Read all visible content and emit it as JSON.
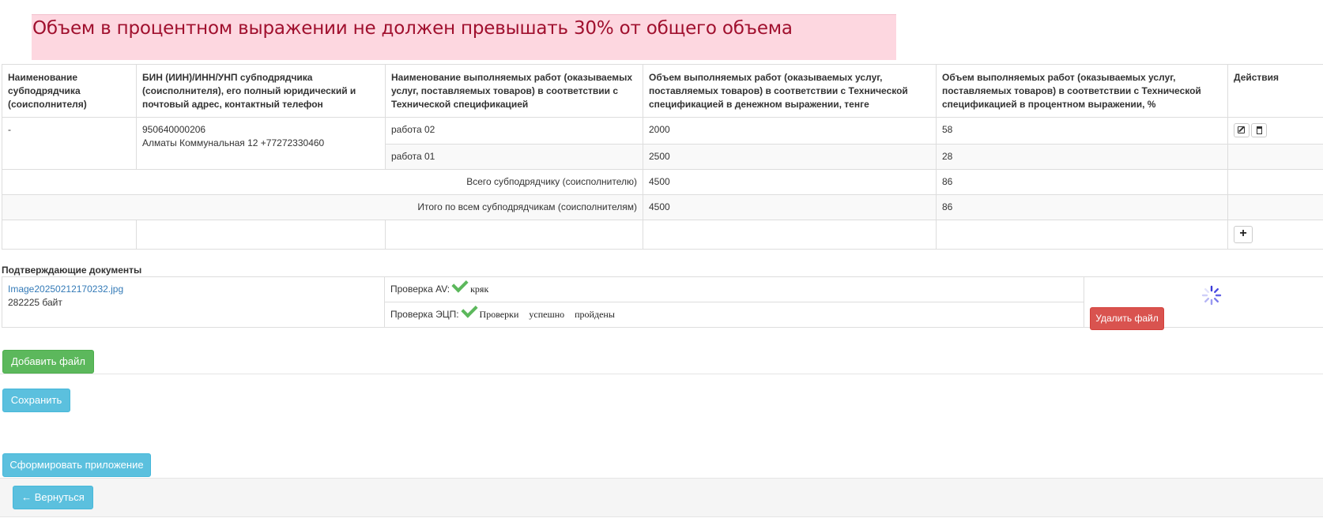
{
  "alert": {
    "text": "Объем в процентном выражении не должен превышать 30% от общего объема"
  },
  "table": {
    "headers": [
      "Наименование субподрядчика (соисполнителя)",
      "БИН (ИИН)/ИНН/УНП субподрядчика (соисполнителя), его полный юридический и почтовый адрес, контактный телефон",
      "Наименование выполняемых работ (оказываемых услуг, поставляемых товаров) в соответствии с Технической спецификацией",
      "Объем выполняемых работ (оказываемых услуг, поставляемых товаров) в соответствии с Технической спецификацией в денежном выражении, тенге",
      "Объем выполняемых работ (оказываемых услуг, поставляемых товаров) в соответствии с Технической спецификацией в процентном выражении, %",
      "Действия"
    ],
    "subcontractor": {
      "name": "-",
      "bin": "950640000206",
      "address": "Алматы Коммунальная 12 +77272330460"
    },
    "rows": [
      {
        "work": "работа 02",
        "amount": "2000",
        "percent": "58"
      },
      {
        "work": "работа 01",
        "amount": "2500",
        "percent": "28"
      }
    ],
    "subtotal": {
      "label": "Всего субподрядчику (соисполнителю)",
      "amount": "4500",
      "percent": "86"
    },
    "total": {
      "label": "Итого по всем субподрядчикам (соисполнителям)",
      "amount": "4500",
      "percent": "86"
    },
    "icons": {
      "edit": "edit-icon",
      "delete": "trash-icon",
      "add": "plus-icon"
    }
  },
  "docs": {
    "title": "Подтверждающие документы",
    "file_name": "Image20250212170232.jpg",
    "file_size": "282225 байт",
    "av_label": "Проверка AV:",
    "av_result": "кряк",
    "sig_label": "Проверка ЭЦП:",
    "sig_result": "Проверки успешно пройдены",
    "delete_button": "Удалить файл"
  },
  "buttons": {
    "add_file": "Добавить файл",
    "save": "Сохранить",
    "generate": "Сформировать приложение",
    "back": "← Вернуться"
  },
  "colors": {
    "alert_bg": "#fdd7e0",
    "alert_text": "#a0102e",
    "success": "#5cb85c",
    "info": "#5bc0de",
    "danger": "#d9534f",
    "link": "#337ab7"
  }
}
